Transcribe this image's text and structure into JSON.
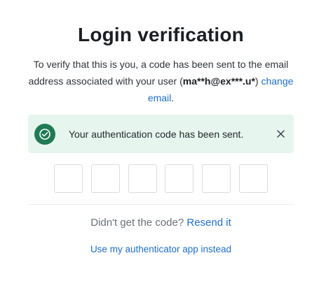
{
  "page": {
    "title": "Login verification"
  },
  "description": {
    "line_before": "To verify that this is you, a code has been sent to the email address associated with your user (",
    "masked_email": "ma**h@ex***.u*",
    "line_after": ")",
    "change_email_link": "change email",
    "period": "."
  },
  "alert": {
    "message": "Your authentication code has been sent.",
    "icon": "check-circle-icon",
    "close_icon": "close-icon",
    "colors": {
      "background": "#e6f6ee",
      "icon_background": "#1f7a55"
    }
  },
  "code_inputs": [
    {
      "value": "",
      "placeholder": ""
    },
    {
      "value": "",
      "placeholder": ""
    },
    {
      "value": "",
      "placeholder": ""
    },
    {
      "value": "",
      "placeholder": ""
    },
    {
      "value": "",
      "placeholder": ""
    },
    {
      "value": "",
      "placeholder": ""
    }
  ],
  "resend": {
    "prompt": "Didn't get the code?",
    "link": "Resend it"
  },
  "authenticator": {
    "link": "Use my authenticator app instead"
  },
  "colors": {
    "link": "#1f6fc7",
    "title": "#1c1f24"
  }
}
